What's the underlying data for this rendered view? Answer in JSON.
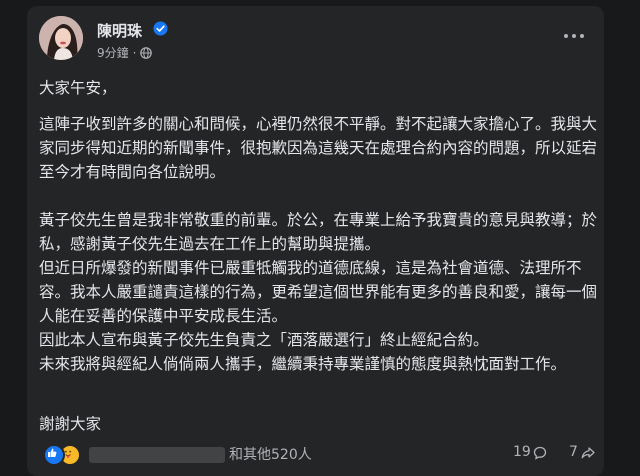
{
  "post": {
    "author": "陳明珠",
    "time": "9分鐘",
    "separator": "·",
    "paragraphs": [
      "大家午安，",
      "這陣子收到許多的關心和問候，心裡仍然很不平靜。對不起讓大家擔心了。我與大家同步得知近期的新聞事件，很抱歉因為這幾天在處理合約內容的問題，所以延宕至今才有時間向各位說明。",
      "黃子佼先生曾是我非常敬重的前輩。於公，在專業上給予我寶貴的意見與教導；於私，感謝黃子佼先生過去在工作上的幫助與提攜。",
      "但近日所爆發的新聞事件已嚴重牴觸我的道德底線，這是為社會道德、法理所不容。我本人嚴重譴責這樣的行為，更希望這個世界能有更多的善良和愛，讓每一個人能在妥善的保護中平安成長生活。",
      "因此本人宣布與黃子佼先生負責之「酒落嚴選行」終止經紀合約。",
      "未來我將與經紀人倘倘兩人攜手，繼續秉持專業謹慎的態度與熱忱面對工作。",
      "謝謝大家"
    ]
  },
  "footer": {
    "reactions_text": "和其他520人",
    "comments": "19",
    "shares": "7"
  },
  "colors": {
    "background": "#18191a",
    "card": "#242526",
    "text": "#e4e6eb",
    "secondary_text": "#b0b3b8",
    "verified": "#1877f2"
  }
}
